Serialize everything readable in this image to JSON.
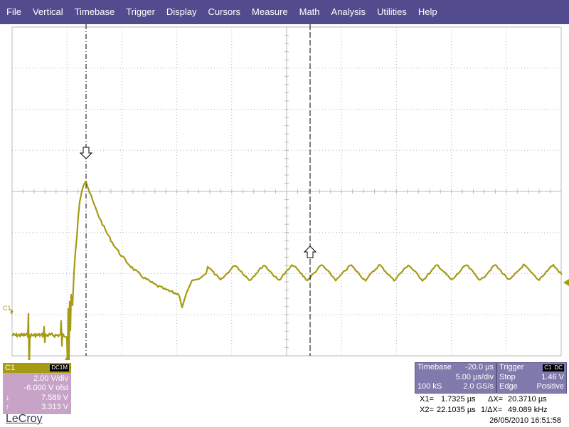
{
  "menu": [
    "File",
    "Vertical",
    "Timebase",
    "Trigger",
    "Display",
    "Cursors",
    "Measure",
    "Math",
    "Analysis",
    "Utilities",
    "Help"
  ],
  "colors": {
    "menubar": "#524c8e",
    "trace": "#a59b14",
    "channel_panel": "#c7a3c7",
    "info_panel": "#817aad",
    "grid": "#b8b8b8"
  },
  "screen": {
    "channel_marker": "C1"
  },
  "channel_panel": {
    "name": "C1",
    "coupling": "DC1M",
    "vdiv": "2.00 V/div",
    "offset": "-6.000 V ofst",
    "max_value": "7.589 V",
    "min_value": "3.313 V"
  },
  "timebase_panel": {
    "title": "Timebase",
    "delay": "-20.0 µs",
    "tdiv": "5.00 µs/div",
    "samples": "100 kS",
    "sample_rate": "2.0 GS/s"
  },
  "trigger_panel": {
    "title": "Trigger",
    "source": "C1",
    "coupling": "DC",
    "mode": "Stop",
    "level": "1.46 V",
    "type": "Edge",
    "slope": "Positive"
  },
  "cursor_readout": {
    "x1_label": "X1=",
    "x1": "1.7325 µs",
    "dx_label": "ΔX=",
    "dx": "20.3710 µs",
    "x2_label": "X2=",
    "x2": "22.1035 µs",
    "inv_dx_label": "1/ΔX=",
    "inv_dx": "49.089 kHz"
  },
  "brand": "LeCroy",
  "datetime": "26/05/2010 16:51:58"
}
